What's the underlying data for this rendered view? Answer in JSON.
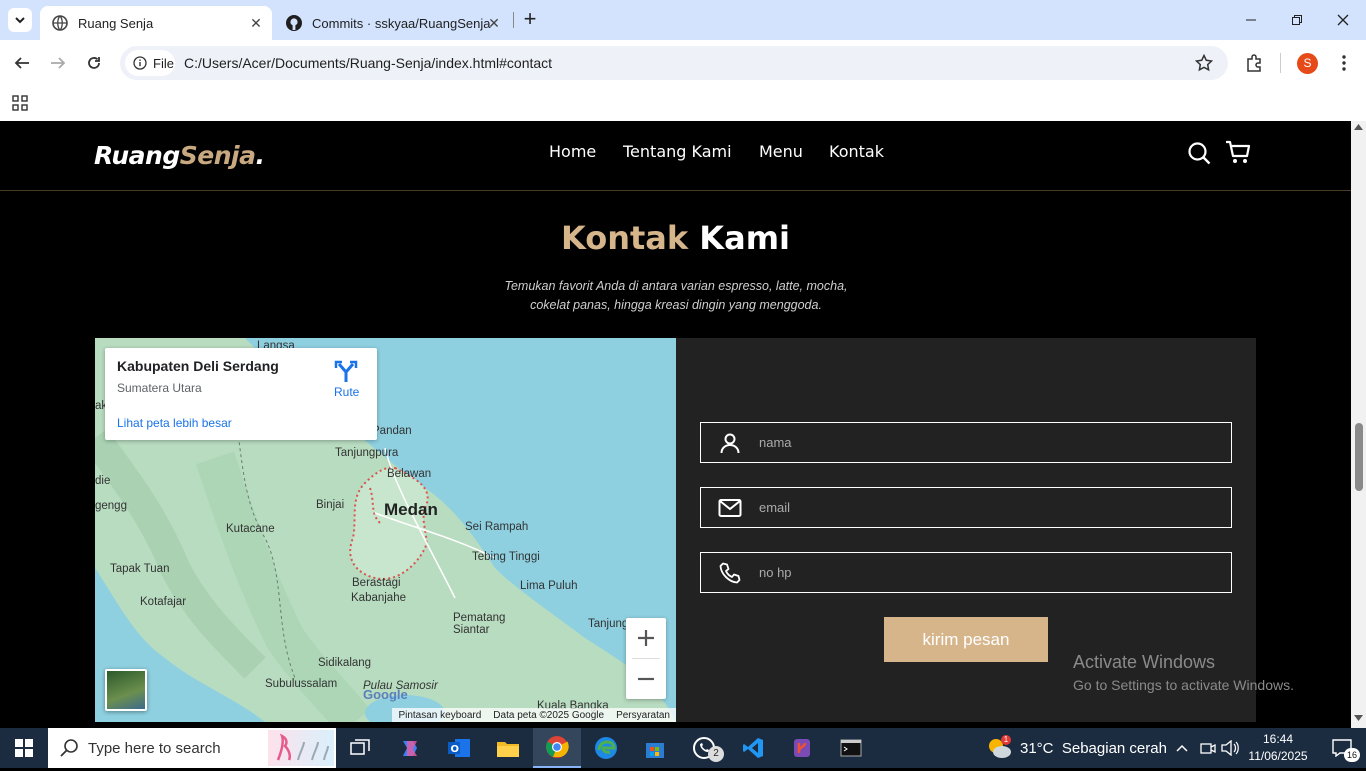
{
  "browser": {
    "tabs": [
      {
        "title": "Ruang Senja",
        "active": true
      },
      {
        "title": "Commits · sskyaa/RuangSenja",
        "active": false
      }
    ],
    "url_chip": "File",
    "url": "C:/Users/Acer/Documents/Ruang-Senja/index.html#contact",
    "profile_initial": "S"
  },
  "site": {
    "logo_main": "Ruang",
    "logo_accent": "Senja",
    "logo_dot": ".",
    "nav": [
      "Home",
      "Tentang Kami",
      "Menu",
      "Kontak"
    ],
    "heading_accent": "Kontak",
    "heading_rest": "Kami",
    "subtitle_line1": "Temukan favorit Anda di antara varian espresso, latte, mocha,",
    "subtitle_line2": "cokelat panas, hingga kreasi dingin yang menggoda.",
    "accent_color": "#d6b58b"
  },
  "map": {
    "place_title": "Kabupaten Deli Serdang",
    "place_subtitle": "Sumatera Utara",
    "larger_map_link": "Lihat peta lebih besar",
    "directions_label": "Rute",
    "cities": [
      "Medan",
      "Binjai",
      "Belawan",
      "Tanjungpura",
      "Kutacane",
      "Sei Rampah",
      "Tebing Tinggi",
      "Tapak Tuan",
      "Kotafajar",
      "Berastagi",
      "Kabanjahe",
      "Lima Puluh",
      "Pematang Siantar",
      "Tanjung",
      "Sidikalang",
      "Subulussalam",
      "Pulau Samosir",
      "Kuala Bangka",
      "Pandan",
      "Langsa",
      "die",
      "gengg",
      "ak"
    ],
    "attribution": [
      "Pintasan keyboard",
      "Data peta ©2025 Google",
      "Persyaratan"
    ],
    "google_logo": "Google"
  },
  "form": {
    "name_placeholder": "nama",
    "email_placeholder": "email",
    "phone_placeholder": "no hp",
    "submit_label": "kirim pesan"
  },
  "windows": {
    "watermark_title": "Activate Windows",
    "watermark_text": "Go to Settings to activate Windows.",
    "search_placeholder": "Type here to search",
    "weather_temp": "31°C",
    "weather_desc": "Sebagian cerah",
    "time": "16:44",
    "date": "11/06/2025",
    "notification_count": "16",
    "whatsapp_badge": "2",
    "weather_badge": "1"
  }
}
